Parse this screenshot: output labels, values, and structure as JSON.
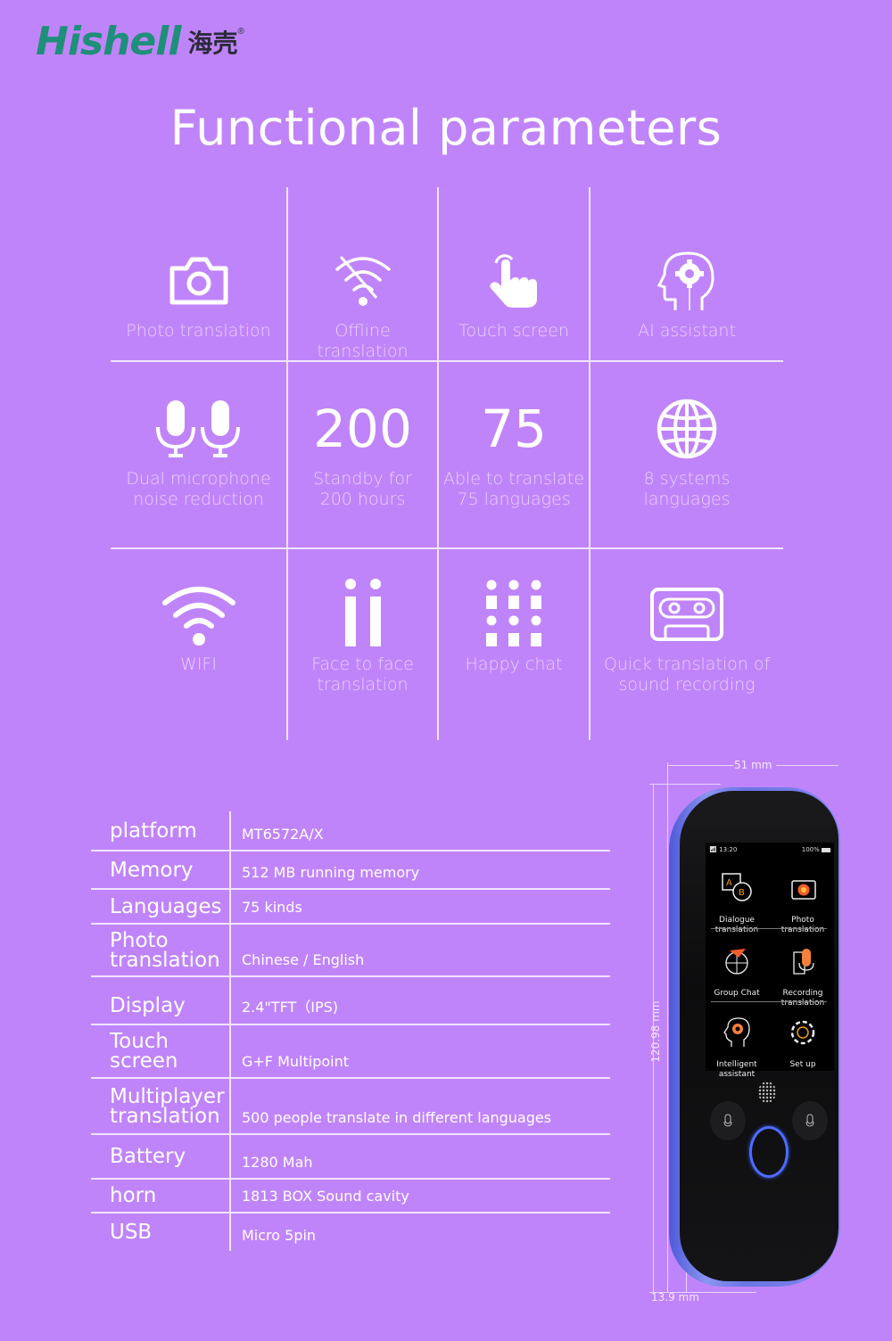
{
  "brand": {
    "name": "Hishell",
    "name_cn": "海壳",
    "registered_mark": "®",
    "brand_color": "#1e8f78"
  },
  "title": "Functional parameters",
  "features": [
    {
      "icon": "camera-icon",
      "label": "Photo translation"
    },
    {
      "icon": "wifi-off-icon",
      "label": "Offline translation"
    },
    {
      "icon": "touch-hand-icon",
      "label": "Touch screen"
    },
    {
      "icon": "ai-head-gear-icon",
      "label": "AI assistant"
    },
    {
      "icon": "dual-microphone-icon",
      "label": "Dual microphone\nnoise reduction"
    },
    {
      "number": "200",
      "label": "Standby for\n200 hours"
    },
    {
      "number": "75",
      "label": "Able to translate\n75 languages"
    },
    {
      "icon": "globe-icon",
      "label": "8 systems\nlanguages"
    },
    {
      "icon": "wifi-icon",
      "label": "WIFI"
    },
    {
      "icon": "face-to-face-icon",
      "label": "Face to face\ntranslation"
    },
    {
      "icon": "people-grid-icon",
      "label": "Happy chat"
    },
    {
      "icon": "cassette-icon",
      "label": "Quick translation of\nsound recording"
    }
  ],
  "specs": [
    {
      "key": "platform",
      "value": "MT6572A/X"
    },
    {
      "key": "Memory",
      "value": "512 MB  running memory"
    },
    {
      "key": "Languages",
      "value": "75 kinds"
    },
    {
      "key": "Photo\ntranslation",
      "value": "Chinese / English"
    },
    {
      "key": "Display",
      "value": "2.4\"TFT（IPS)"
    },
    {
      "key": "Touch\nscreen",
      "value": "G+F Multipoint"
    },
    {
      "key": "Multiplayer\ntranslation",
      "value": "500 people translate in different languages"
    },
    {
      "key": "Battery",
      "value": "1280 Mah"
    },
    {
      "key": "horn",
      "value": "1813 BOX Sound cavity"
    },
    {
      "key": "USB",
      "value": "Micro 5pin"
    }
  ],
  "device": {
    "width_label": "51 mm",
    "height_label": "120.98 mm",
    "depth_label": "13.9 mm",
    "screen": {
      "time": "13:20",
      "battery": "100%",
      "apps": [
        {
          "icon": "dialogue-icon",
          "label": "Dialogue\ntranslation"
        },
        {
          "icon": "photo-camera-icon",
          "label": "Photo\ntranslation"
        },
        {
          "icon": "group-chat-globe-icon",
          "label": "Group Chat"
        },
        {
          "icon": "recording-mic-icon",
          "label": "Recording\ntranslation"
        },
        {
          "icon": "intelligent-head-icon",
          "label": "Intelligent\nassistant"
        },
        {
          "icon": "settings-gear-icon",
          "label": "Set up"
        }
      ]
    }
  }
}
